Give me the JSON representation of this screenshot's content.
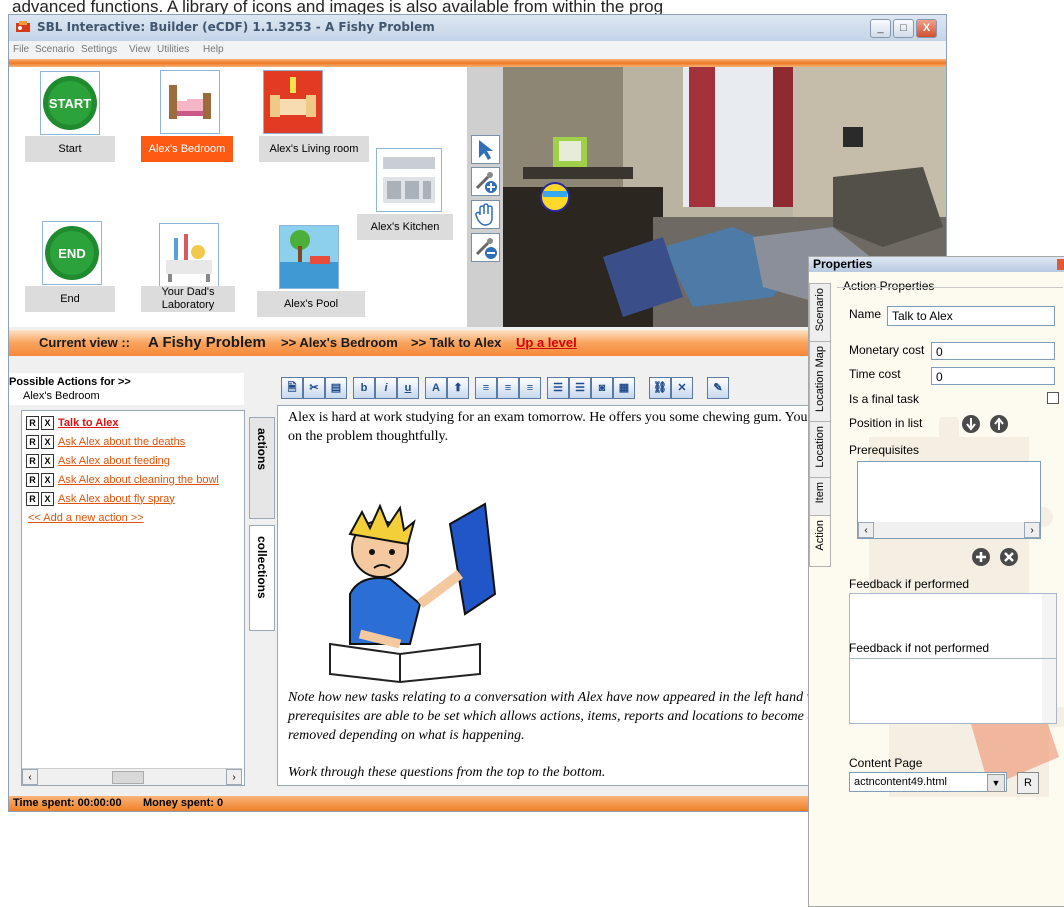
{
  "page_caption": "advanced functions.  A library of icons and images is also available from within the prog",
  "window": {
    "title": "SBL Interactive: Builder (eCDF) 1.1.3253 - A Fishy Problem",
    "controls": {
      "minimize": "_",
      "maximize": "□",
      "close": "X"
    }
  },
  "menu": [
    "File",
    "Scenario",
    "Settings",
    "View",
    "Utilities",
    "Help"
  ],
  "locations": [
    {
      "label": "Start",
      "icon": "start-icon",
      "icon_text": "START"
    },
    {
      "label": "Alex's Bedroom",
      "icon": "bed-icon",
      "selected": true
    },
    {
      "label": "Alex's Living room",
      "icon": "armchair-icon"
    },
    {
      "label": "Alex's Kitchen",
      "icon": "kitchen-icon"
    },
    {
      "label": "End",
      "icon": "end-icon",
      "icon_text": "END"
    },
    {
      "label": "Your Dad's Laboratory",
      "icon": "laboratory-icon"
    },
    {
      "label": "Alex's Pool",
      "icon": "pool-icon"
    }
  ],
  "map_tools": [
    "pointer-icon",
    "add-tool-icon",
    "hand-icon",
    "remove-tool-icon"
  ],
  "breadcrumb": {
    "prefix": "Current view ::",
    "scenario": "A Fishy Problem",
    "location": ">> Alex's Bedroom",
    "action": ">> Talk to Alex",
    "up_link": "Up a level"
  },
  "possible_actions": {
    "heading": "Possible Actions for >>",
    "location": "Alex's Bedroom",
    "r_label": "R",
    "x_label": "X",
    "items": [
      {
        "label": "Talk to Alex",
        "active": true
      },
      {
        "label": "Ask Alex about the deaths"
      },
      {
        "label": "Ask Alex about feeding"
      },
      {
        "label": "Ask Alex about cleaning the bowl"
      },
      {
        "label": "Ask Alex about fly spray"
      }
    ],
    "add_link": "<< Add a new action >>"
  },
  "side_tabs": {
    "actions": "actions",
    "collections": "collections"
  },
  "format_toolbar": [
    {
      "name": "open-page-icon",
      "glyph": "🗎"
    },
    {
      "name": "cut-icon",
      "glyph": "✂"
    },
    {
      "name": "paste-icon",
      "glyph": "▤"
    },
    {
      "name": "bold-button",
      "glyph": "b"
    },
    {
      "name": "italic-button",
      "glyph": "i"
    },
    {
      "name": "underline-button",
      "glyph": "u"
    },
    {
      "name": "font-color-icon",
      "glyph": "A"
    },
    {
      "name": "highlight-icon",
      "glyph": "⬆"
    },
    {
      "name": "align-left-icon",
      "glyph": "≡"
    },
    {
      "name": "align-center-icon",
      "glyph": "≡"
    },
    {
      "name": "align-right-icon",
      "glyph": "≡"
    },
    {
      "name": "numbered-list-icon",
      "glyph": "☰"
    },
    {
      "name": "bullet-list-icon",
      "glyph": "☰"
    },
    {
      "name": "insert-image-icon",
      "glyph": "◙"
    },
    {
      "name": "insert-table-icon",
      "glyph": "▦"
    },
    {
      "name": "insert-link-icon",
      "glyph": "⛓"
    },
    {
      "name": "remove-link-icon",
      "glyph": "✕"
    },
    {
      "name": "edit-source-icon",
      "glyph": "✎"
    }
  ],
  "content": {
    "paragraph1": "Alex is hard at work studying for an exam tomorrow.  He offers you some chewing gum. You take it and chew on the problem thoughtfully.",
    "note": "Note how new tasks relating to a conversation with Alex have now appeared in the left hand window.  In PBLi, prerequisites are able to be set which allows actions, items, reports and locations to become available, or be removed depending on what is happening.",
    "instruction": "Work through these questions from the top to the bottom."
  },
  "status": {
    "time_spent": "Time spent: 00:00:00",
    "money_spent": "Money spent: 0"
  },
  "properties": {
    "title": "Properties",
    "tabs": [
      "Scenario",
      "Location Map",
      "Location",
      "Item",
      "Action"
    ],
    "group_label": "Action Properties",
    "name_label": "Name",
    "name_value": "Talk to Alex",
    "monetary_label": "Monetary cost",
    "monetary_value": "0",
    "time_label": "Time cost",
    "time_value": "0",
    "final_label": "Is a final task",
    "final_checked": false,
    "position_label": "Position in list",
    "prereq_label": "Prerequisites",
    "feedback_performed_label": "Feedback if performed",
    "feedback_not_label": "Feedback if not performed",
    "content_page_label": "Content Page",
    "content_page_value": "actncontent49.html",
    "r_button": "R"
  },
  "colors": {
    "accent": "#f07c22",
    "selected": "#ff5a14",
    "link": "#e2530b"
  }
}
